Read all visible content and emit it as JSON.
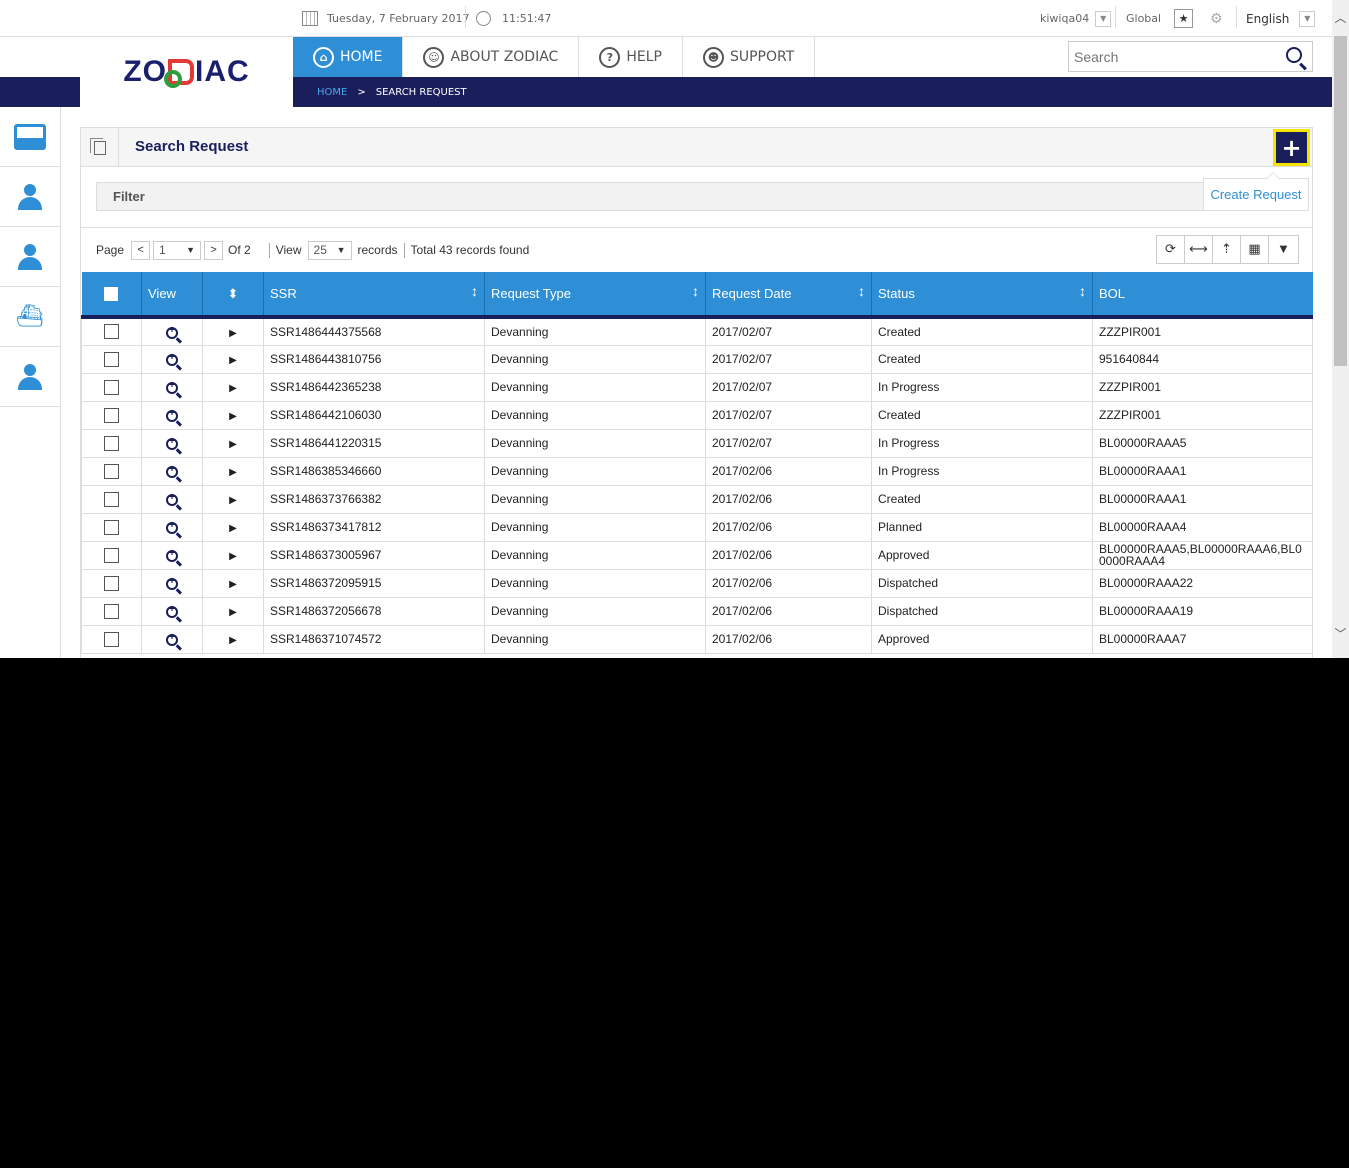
{
  "topbar": {
    "date": "Tuesday, 7 February 2017",
    "time": "11:51:47",
    "user": "kiwiqa04",
    "region": "Global",
    "language": "English"
  },
  "logo_text_left": "ZO",
  "logo_text_right": "IAC",
  "nav": {
    "tabs": [
      {
        "label": "HOME",
        "icon": "home-icon"
      },
      {
        "label": "ABOUT ZODIAC",
        "icon": "people-icon"
      },
      {
        "label": "HELP",
        "icon": "question-icon"
      },
      {
        "label": "SUPPORT",
        "icon": "support-icon"
      }
    ],
    "active": "HOME"
  },
  "breadcrumb": {
    "home": "HOME",
    "separator": ">",
    "current": "SEARCH REQUEST"
  },
  "search": {
    "placeholder": "Search"
  },
  "sidebar": {
    "items": [
      {
        "icon": "inbox-icon"
      },
      {
        "icon": "user-icon"
      },
      {
        "icon": "user-icon"
      },
      {
        "icon": "ship-icon"
      },
      {
        "icon": "user-icon"
      }
    ]
  },
  "panel": {
    "title": "Search Request",
    "add_symbol": "+",
    "add_tooltip": "Create Request",
    "filter_label": "Filter"
  },
  "pager": {
    "page_label": "Page",
    "page_value": "1",
    "of_label": "Of 2",
    "view_label": "View",
    "view_value": "25",
    "records_label": "records",
    "total_label": "Total 43 records found"
  },
  "table": {
    "columns": [
      "View",
      "SSR",
      "Request Type",
      "Request Date",
      "Status",
      "BOL"
    ],
    "rows": [
      {
        "ssr": "SSR1486444375568",
        "type": "Devanning",
        "date": "2017/02/07",
        "status": "Created",
        "bol": "ZZZPIR001"
      },
      {
        "ssr": "SSR1486443810756",
        "type": "Devanning",
        "date": "2017/02/07",
        "status": "Created",
        "bol": "951640844"
      },
      {
        "ssr": "SSR1486442365238",
        "type": "Devanning",
        "date": "2017/02/07",
        "status": "In Progress",
        "bol": "ZZZPIR001"
      },
      {
        "ssr": "SSR1486442106030",
        "type": "Devanning",
        "date": "2017/02/07",
        "status": "Created",
        "bol": "ZZZPIR001"
      },
      {
        "ssr": "SSR1486441220315",
        "type": "Devanning",
        "date": "2017/02/07",
        "status": "In Progress",
        "bol": "BL00000RAAA5"
      },
      {
        "ssr": "SSR1486385346660",
        "type": "Devanning",
        "date": "2017/02/06",
        "status": "In Progress",
        "bol": "BL00000RAAA1"
      },
      {
        "ssr": "SSR1486373766382",
        "type": "Devanning",
        "date": "2017/02/06",
        "status": "Created",
        "bol": "BL00000RAAA1"
      },
      {
        "ssr": "SSR1486373417812",
        "type": "Devanning",
        "date": "2017/02/06",
        "status": "Planned",
        "bol": "BL00000RAAA4"
      },
      {
        "ssr": "SSR1486373005967",
        "type": "Devanning",
        "date": "2017/02/06",
        "status": "Approved",
        "bol": "BL00000RAAA5,BL00000RAAA6,BL00000RAAA4"
      },
      {
        "ssr": "SSR1486372095915",
        "type": "Devanning",
        "date": "2017/02/06",
        "status": "Dispatched",
        "bol": "BL00000RAAA22"
      },
      {
        "ssr": "SSR1486372056678",
        "type": "Devanning",
        "date": "2017/02/06",
        "status": "Dispatched",
        "bol": "BL00000RAAA19"
      },
      {
        "ssr": "SSR1486371074572",
        "type": "Devanning",
        "date": "2017/02/06",
        "status": "Approved",
        "bol": "BL00000RAAA7"
      }
    ]
  },
  "colors": {
    "navy": "#1a1f5c",
    "blue": "#2e8fd6",
    "highlight": "#f5e400",
    "logo_red": "#e53935",
    "logo_green": "#2e9e3e"
  }
}
